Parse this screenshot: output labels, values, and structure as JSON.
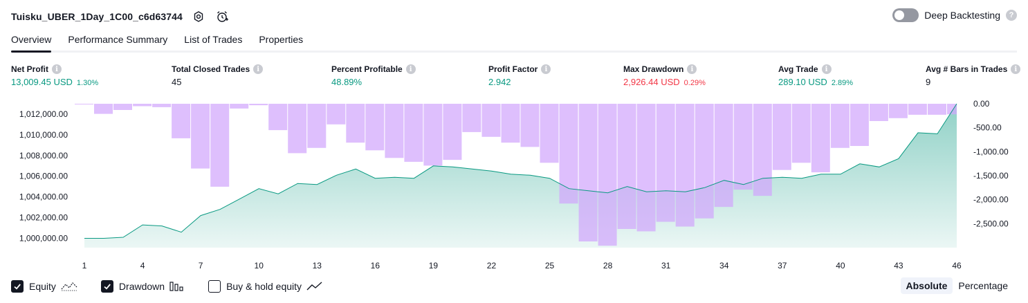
{
  "header": {
    "title": "Tuisku_UBER_1Day_1C00_c6d63744",
    "deep_backtesting_label": "Deep Backtesting",
    "help_glyph": "?"
  },
  "tabs": [
    {
      "label": "Overview",
      "active": true
    },
    {
      "label": "Performance Summary",
      "active": false
    },
    {
      "label": "List of Trades",
      "active": false
    },
    {
      "label": "Properties",
      "active": false
    }
  ],
  "info_glyph": "i",
  "metrics": [
    {
      "label": "Net Profit",
      "value": "13,009.45 USD",
      "pct": "1.30%",
      "tone": "green"
    },
    {
      "label": "Total Closed Trades",
      "value": "45",
      "pct": "",
      "tone": "dark"
    },
    {
      "label": "Percent Profitable",
      "value": "48.89%",
      "pct": "",
      "tone": "green"
    },
    {
      "label": "Profit Factor",
      "value": "2.942",
      "pct": "",
      "tone": "green"
    },
    {
      "label": "Max Drawdown",
      "value": "2,926.44 USD",
      "pct": "0.29%",
      "tone": "red"
    },
    {
      "label": "Avg Trade",
      "value": "289.10 USD",
      "pct": "2.89%",
      "tone": "green"
    },
    {
      "label": "Avg # Bars in Trades",
      "value": "9",
      "pct": "",
      "tone": "dark"
    }
  ],
  "chart_data": {
    "type": "line",
    "x": [
      1,
      2,
      3,
      4,
      5,
      6,
      7,
      8,
      9,
      10,
      11,
      12,
      13,
      14,
      15,
      16,
      17,
      18,
      19,
      20,
      21,
      22,
      23,
      24,
      25,
      26,
      27,
      28,
      29,
      30,
      31,
      32,
      33,
      34,
      35,
      36,
      37,
      38,
      39,
      40,
      41,
      42,
      43,
      44,
      45,
      46
    ],
    "x_tick_labels": [
      "1",
      "4",
      "7",
      "10",
      "13",
      "16",
      "19",
      "22",
      "25",
      "28",
      "31",
      "34",
      "37",
      "40",
      "43",
      "46"
    ],
    "series": [
      {
        "name": "Equity",
        "axis": "left",
        "color": "#089981",
        "values": [
          1000000,
          1000000,
          1000100,
          1001300,
          1001200,
          1000600,
          1002200,
          1002800,
          1003800,
          1004800,
          1004300,
          1005300,
          1005200,
          1006100,
          1006700,
          1005800,
          1005900,
          1005800,
          1007000,
          1006900,
          1006700,
          1006500,
          1006200,
          1006100,
          1005800,
          1004800,
          1004600,
          1004400,
          1005000,
          1004500,
          1004600,
          1004500,
          1004900,
          1005600,
          1005200,
          1005800,
          1005900,
          1005800,
          1006200,
          1006200,
          1007200,
          1006900,
          1007700,
          1010200,
          1010100,
          1013000
        ]
      },
      {
        "name": "Drawdown",
        "axis": "right",
        "color": "#d1a6fc",
        "values": [
          -10,
          -210,
          -130,
          -50,
          -70,
          -720,
          -1350,
          -1730,
          -100,
          -30,
          -550,
          -1030,
          -920,
          -430,
          -810,
          -970,
          -1130,
          -1210,
          -1290,
          -1170,
          -590,
          -690,
          -810,
          -900,
          -1230,
          -2080,
          -2870,
          -2960,
          -2610,
          -2660,
          -2460,
          -2560,
          -2390,
          -2150,
          -1790,
          -1920,
          -1380,
          -1230,
          -1430,
          -920,
          -880,
          -360,
          -300,
          -230,
          -230,
          -220
        ]
      }
    ],
    "y_left": {
      "min": 999100,
      "max": 1013000,
      "ticks": [
        "1,000,000.00",
        "1,002,000.00",
        "1,004,000.00",
        "1,006,000.00",
        "1,008,000.00",
        "1,010,000.00",
        "1,012,000.00"
      ],
      "tick_values": [
        1000000,
        1002000,
        1004000,
        1006000,
        1008000,
        1010000,
        1012000
      ]
    },
    "y_right": {
      "min": -3000,
      "max": 0,
      "ticks": [
        "0.00",
        "-500.00",
        "-1,000.00",
        "-1,500.00",
        "-2,000.00",
        "-2,500.00"
      ],
      "tick_values": [
        0,
        -500,
        -1000,
        -1500,
        -2000,
        -2500
      ]
    },
    "grid": false,
    "legend_position": "bottom-left"
  },
  "legend": [
    {
      "label": "Equity",
      "checked": true
    },
    {
      "label": "Drawdown",
      "checked": true
    },
    {
      "label": "Buy & hold equity",
      "checked": false
    }
  ],
  "mode": [
    {
      "label": "Absolute",
      "active": true
    },
    {
      "label": "Percentage",
      "active": false
    }
  ]
}
